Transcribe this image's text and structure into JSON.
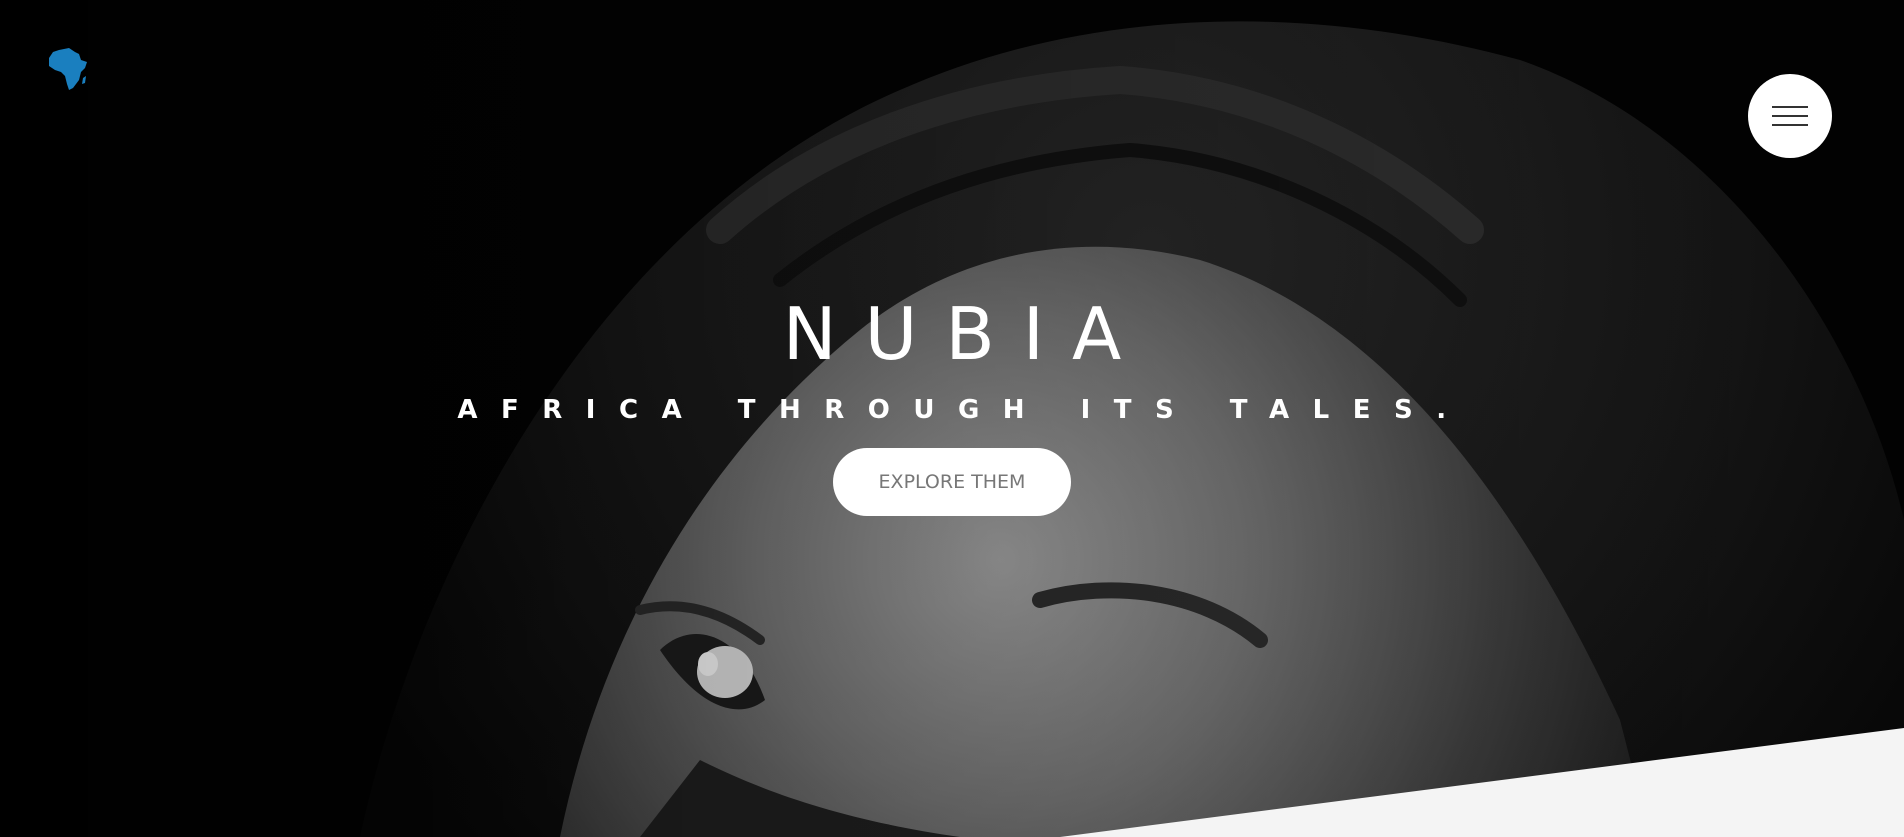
{
  "header": {
    "logo_icon": "africa-map-icon",
    "logo_color": "#1a7fbf",
    "menu_icon": "hamburger-icon"
  },
  "hero": {
    "title": "NUBIA",
    "subtitle": "AFRICA THROUGH ITS TALES.",
    "cta_label": "EXPLORE THEM"
  },
  "colors": {
    "background": "#020202",
    "text": "#ffffff",
    "button_bg": "#ffffff",
    "button_text": "#777777",
    "bottom_band": "#f4f4f4"
  }
}
